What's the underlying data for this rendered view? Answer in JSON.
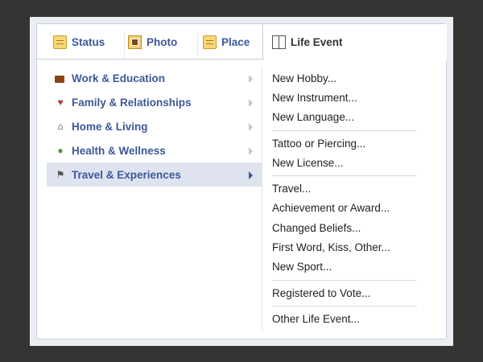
{
  "tabs": {
    "status": "Status",
    "photo": "Photo",
    "place": "Place",
    "life_event": "Life Event"
  },
  "categories": [
    {
      "label": "Work & Education",
      "icon": "briefcase-icon",
      "icon_color": "#8b4513"
    },
    {
      "label": "Family & Relationships",
      "icon": "heart-icon",
      "icon_color": "#c0392b"
    },
    {
      "label": "Home & Living",
      "icon": "house-icon",
      "icon_color": "#333333"
    },
    {
      "label": "Health & Wellness",
      "icon": "apple-icon",
      "icon_color": "#4a9a2a"
    },
    {
      "label": "Travel & Experiences",
      "icon": "flag-icon",
      "icon_color": "#555555",
      "active": true
    }
  ],
  "event_groups": [
    [
      "New Hobby...",
      "New Instrument...",
      "New Language..."
    ],
    [
      "Tattoo or Piercing...",
      "New License..."
    ],
    [
      "Travel...",
      "Achievement or Award...",
      "Changed Beliefs...",
      "First Word, Kiss, Other...",
      "New Sport..."
    ],
    [
      "Registered to Vote..."
    ],
    [
      "Other Life Event..."
    ]
  ],
  "colors": {
    "link": "#3b5998",
    "active_row": "#dee3ef",
    "background": "#333333"
  }
}
